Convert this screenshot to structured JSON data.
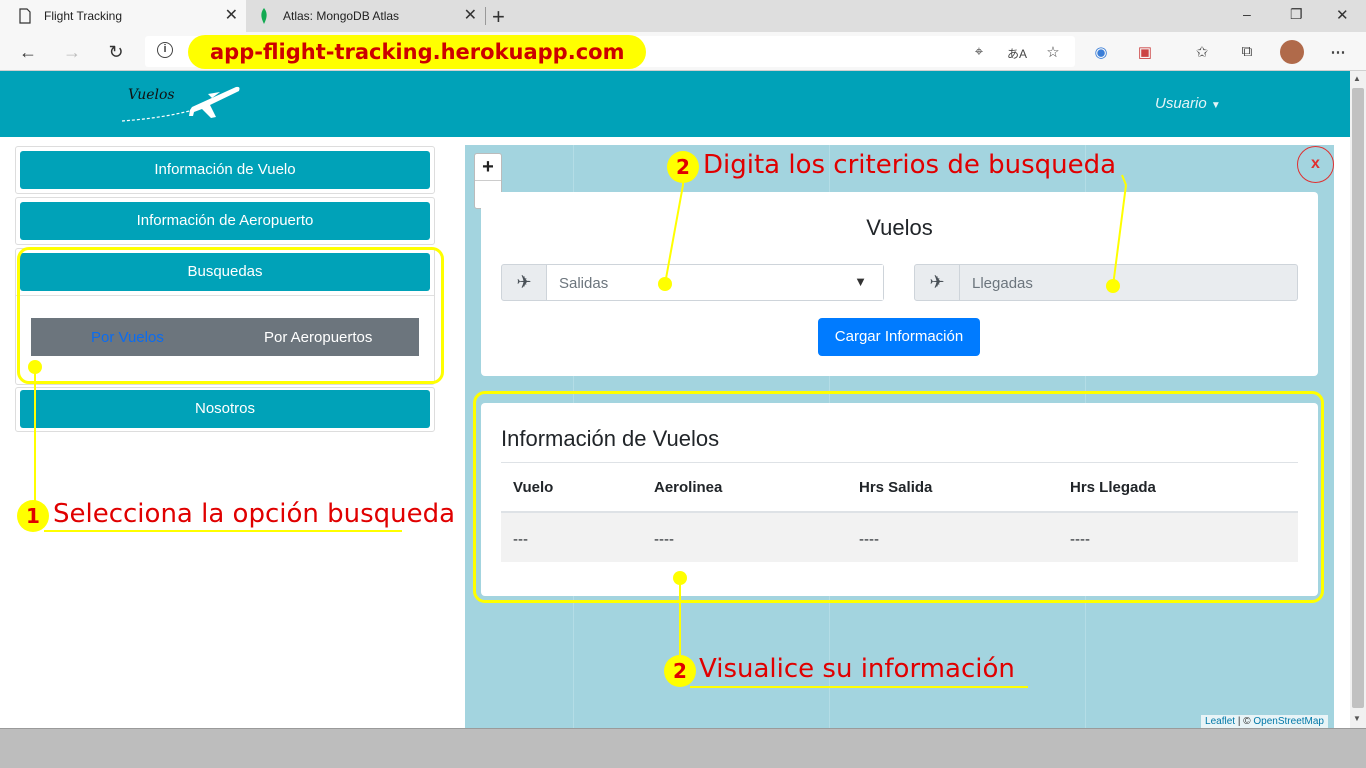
{
  "browser": {
    "tabs": [
      {
        "title": "Flight Tracking",
        "active": true
      },
      {
        "title": "Atlas: MongoDB Atlas",
        "active": false
      }
    ],
    "new_tab": "+",
    "url": "app-flight-tracking.herokuapp.com",
    "window_controls": {
      "minimize": "–",
      "maximize": "❐",
      "close": "✕"
    }
  },
  "navbar": {
    "brand": "Vuelos",
    "user_menu": "Usuario"
  },
  "sidebar": {
    "items": [
      {
        "label": "Información de Vuelo"
      },
      {
        "label": "Información de Aeropuerto"
      },
      {
        "label": "Busquedas"
      },
      {
        "label": "Nosotros"
      }
    ],
    "search_tabs": [
      {
        "label": "Por Vuelos",
        "active": true
      },
      {
        "label": "Por Aeropuertos",
        "active": false
      }
    ]
  },
  "map": {
    "zoom_in": "+",
    "zoom_out": "−",
    "close": "x",
    "attribution_leaflet": "Leaflet",
    "attribution_sep": " | © ",
    "attribution_osm": "OpenStreetMap"
  },
  "search_panel": {
    "title": "Vuelos",
    "departures_placeholder": "Salidas",
    "arrivals_placeholder": "Llegadas",
    "load_button": "Cargar Información"
  },
  "results": {
    "title": "Información de Vuelos",
    "columns": [
      "Vuelo",
      "Aerolinea",
      "Hrs Salida",
      "Hrs Llegada"
    ],
    "rows": [
      [
        "---",
        "----",
        "----",
        "----"
      ]
    ]
  },
  "annotations": {
    "step1_number": "1",
    "step1_text": "Selecciona la opción busqueda",
    "step2_number": "2",
    "step2_text": "Digita los criterios de busqueda",
    "step3_number": "2",
    "step3_text": "Visualice su información"
  },
  "colors": {
    "primary": "#00a2b8",
    "button_blue": "#007bff",
    "highlight": "#ffff00",
    "annotation_red": "#e00000"
  }
}
